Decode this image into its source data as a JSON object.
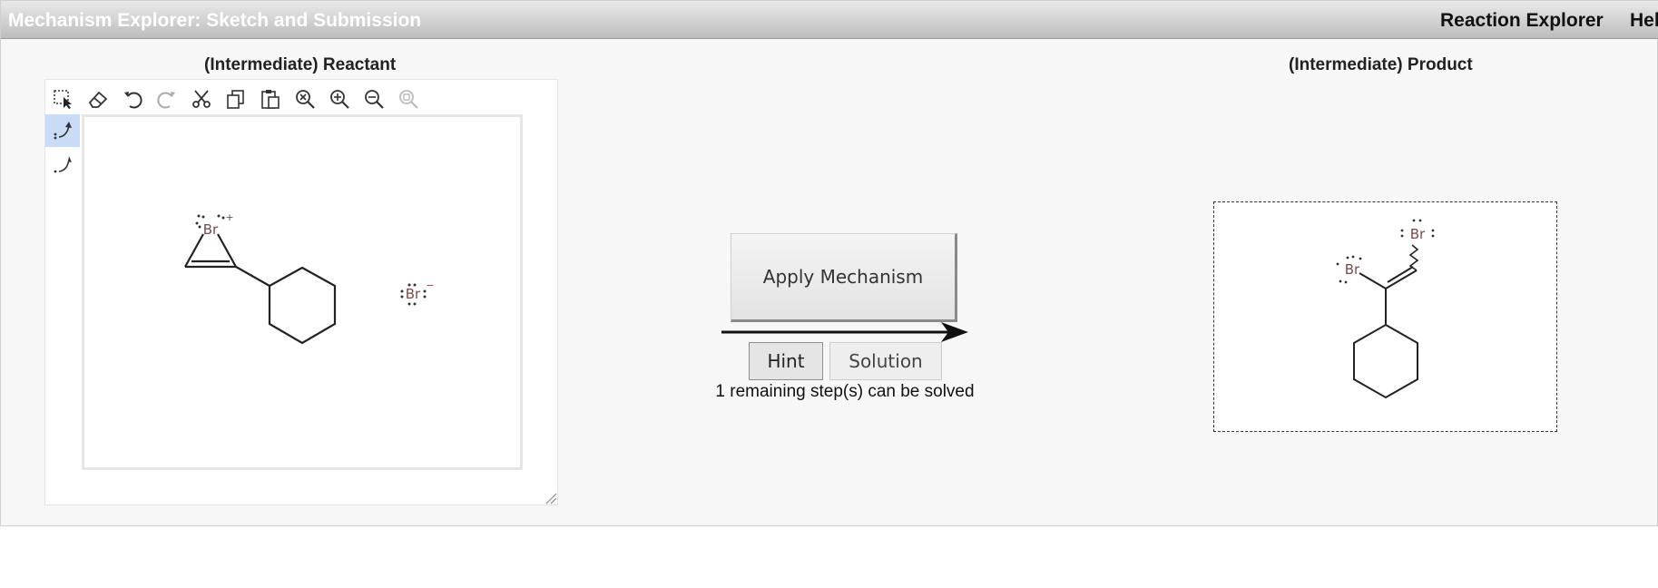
{
  "header": {
    "title": "Mechanism Explorer: Sketch and Submission",
    "nav_reaction_explorer": "Reaction Explorer",
    "nav_help": "Hel"
  },
  "reactant_panel": {
    "heading": "(Intermediate) Reactant",
    "toolbar": [
      "select-icon",
      "eraser-icon",
      "undo-icon",
      "redo-icon",
      "cut-icon",
      "copy-icon",
      "paste-icon",
      "zoom-reset-icon",
      "zoom-in-icon",
      "zoom-out-icon",
      "zoom-fit-icon"
    ],
    "side_tools": [
      "electron-pair-arrow-icon",
      "single-electron-arrow-icon"
    ],
    "molecule": {
      "bromonium_label": "Br",
      "bromonium_charge": "+",
      "bromide_label": "Br",
      "bromide_charge": "−"
    }
  },
  "controls": {
    "apply_label": "Apply Mechanism",
    "hint_label": "Hint",
    "solution_label": "Solution",
    "status_text": "1 remaining step(s) can be solved"
  },
  "product_panel": {
    "heading": "(Intermediate) Product",
    "molecule": {
      "br1_label": "Br",
      "br2_label": "Br"
    }
  },
  "colors": {
    "atom_label": "#7a4a4a",
    "bond": "#222222",
    "toolbar_icon": "#333333",
    "active_tool_bg": "#c9dbf5"
  }
}
